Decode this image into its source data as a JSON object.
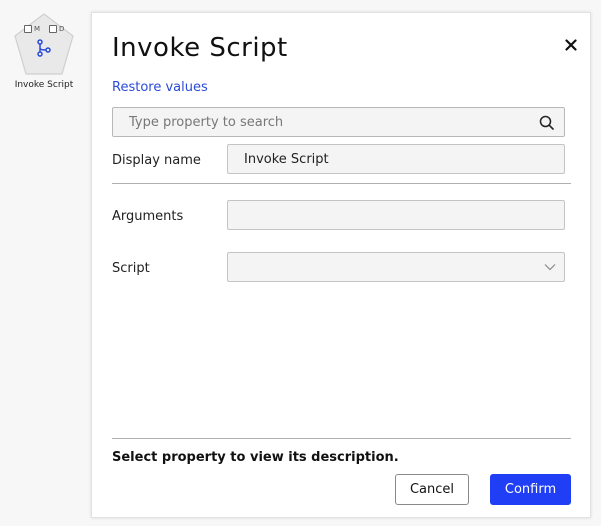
{
  "canvas": {
    "node": {
      "badge_m": "M",
      "badge_d": "D",
      "icon": "branch-icon",
      "label": "Invoke Script"
    }
  },
  "dialog": {
    "title": "Invoke Script",
    "close_icon": "close-icon",
    "restore_label": "Restore values",
    "search": {
      "placeholder": "Type property to search",
      "value": "",
      "icon": "search-icon"
    },
    "properties": [
      {
        "label": "Display name",
        "value": "Invoke Script"
      },
      {
        "label": "Arguments",
        "value": ""
      },
      {
        "label": "Script",
        "value": "",
        "icon": "chevron-down-icon"
      }
    ],
    "description": "Select property to view its description.",
    "cancel_label": "Cancel",
    "confirm_label": "Confirm"
  },
  "colors": {
    "accent": "#1f3ef5",
    "link": "#2a4bd7",
    "background": "#f7f7f7"
  }
}
